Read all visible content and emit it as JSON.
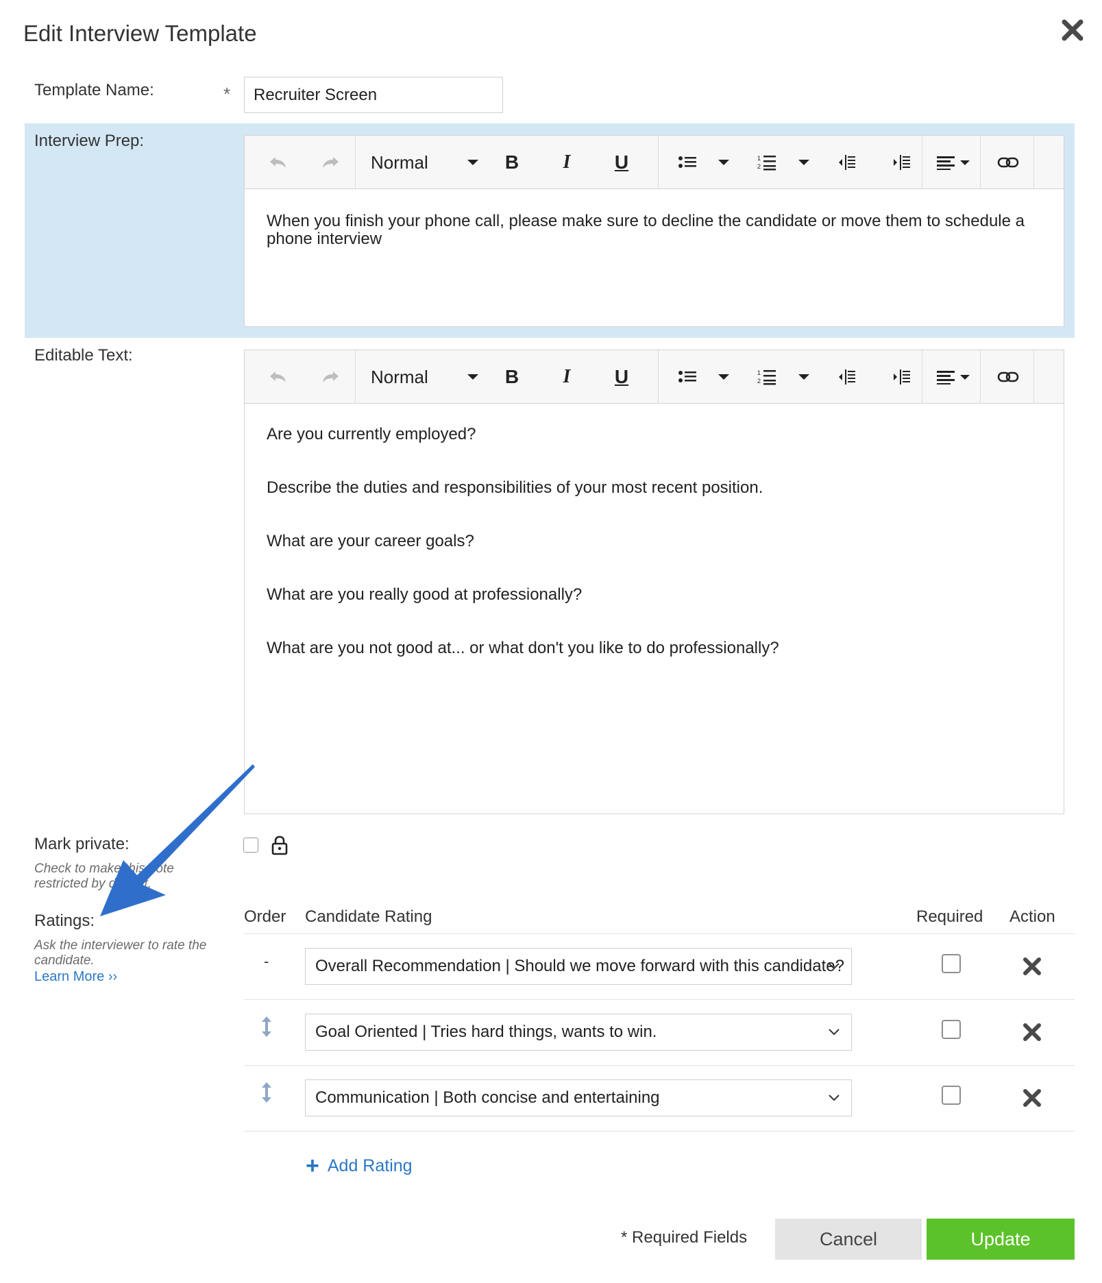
{
  "dialog": {
    "title": "Edit Interview Template",
    "close_icon": "close-icon"
  },
  "template_name": {
    "label": "Template Name:",
    "required_mark": "*",
    "value": "Recruiter Screen"
  },
  "interview_prep": {
    "label": "Interview Prep:",
    "highlight_color": "#d4e7f5",
    "toolbar": {
      "format": "Normal",
      "bold": "B",
      "italic": "I",
      "underline": "U"
    },
    "text": "When you finish your phone call, please make sure to decline the candidate or move them to schedule a phone interview"
  },
  "editable_text": {
    "label": "Editable Text:",
    "toolbar": {
      "format": "Normal",
      "bold": "B",
      "italic": "I",
      "underline": "U"
    },
    "lines": [
      "Are you currently employed?",
      "Describe the duties and responsibilities of your most recent position.",
      "What are your career goals?",
      "What are you really good at professionally?",
      "What are you not good at... or what don't you like to do professionally?"
    ]
  },
  "mark_private": {
    "label": "Mark private:",
    "hint": "Check to make this note restricted by default.",
    "checked": false,
    "icon": "lock-icon"
  },
  "ratings": {
    "label": "Ratings:",
    "hint": "Ask the interviewer to rate the candidate.",
    "learn_more": "Learn More ››",
    "columns": {
      "order": "Order",
      "rating": "Candidate Rating",
      "required": "Required",
      "action": "Action"
    },
    "rows": [
      {
        "order": "-",
        "rating": "Overall Recommendation | Should we move forward with this candidate?",
        "required": false
      },
      {
        "order": "sort",
        "rating": "Goal Oriented | Tries hard things, wants to win.",
        "required": false
      },
      {
        "order": "sort",
        "rating": "Communication | Both concise and entertaining",
        "required": false
      }
    ],
    "add_rating": "Add Rating"
  },
  "footer": {
    "required_fields": "* Required Fields",
    "cancel": "Cancel",
    "update": "Update",
    "update_color": "#5cc22a"
  },
  "annotation": {
    "arrow_color": "#2f6fcb"
  }
}
